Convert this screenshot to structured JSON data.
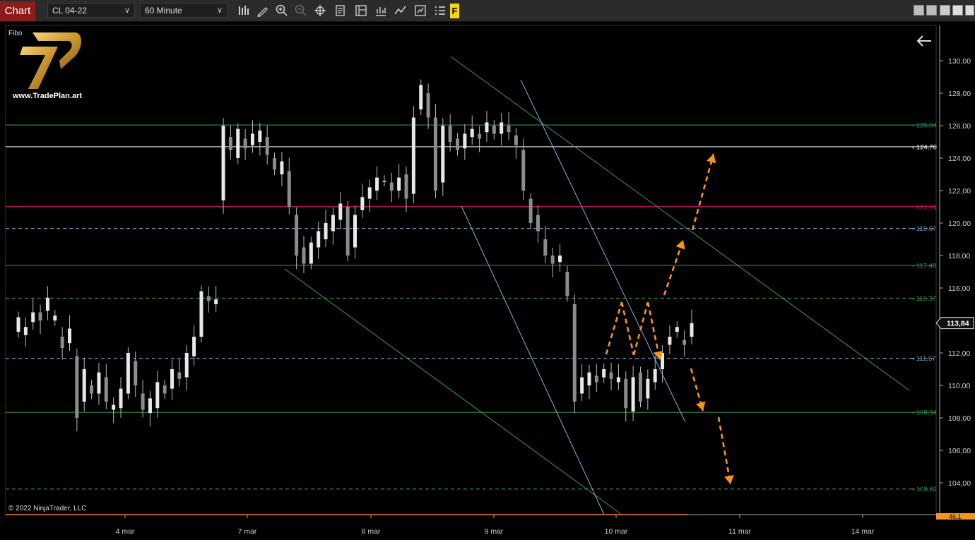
{
  "toolbar": {
    "tab_label": "Chart",
    "instrument": "CL 04-22",
    "interval": "60 Minute",
    "highlight_label": "F"
  },
  "panel": {
    "indicator_label": "Fibo",
    "logo_text": "www.TradePlan.art",
    "copyright": "© 2022 NinjaTrader, LLC",
    "back_icon": "arrow-left-icon"
  },
  "chart_data": {
    "type": "candlestick",
    "instrument": "CL 04-22",
    "interval": "60 Minute",
    "ylim": [
      102.8,
      131.5
    ],
    "yticks": [
      "104,00",
      "106,00",
      "108,00",
      "110,00",
      "112,00",
      "114,00",
      "116,00",
      "118,00",
      "120,00",
      "122,00",
      "124,00",
      "126,00",
      "128,00",
      "130,00"
    ],
    "xtick_labels": [
      "4 mar",
      "7 mar",
      "8 mar",
      "9 mar",
      "10 mar",
      "11 mar",
      "14 mar"
    ],
    "last_price": {
      "value": 113.84,
      "label": "113,84"
    },
    "bottom_price_label": "46,1",
    "levels": [
      {
        "value": 126.04,
        "label": "126,04",
        "color": "#2e8b57",
        "style": "solid"
      },
      {
        "value": 124.7,
        "label": "124,70",
        "color": "#c8c8c8",
        "style": "solid"
      },
      {
        "value": 121.01,
        "label": "121,01",
        "color": "#c2185b",
        "style": "solid"
      },
      {
        "value": 119.67,
        "label": "119,67",
        "color": "#6f93b3",
        "style": "dashed"
      },
      {
        "value": 117.4,
        "label": "117,40",
        "color": "#2e8b57",
        "style": "solid"
      },
      {
        "value": 115.37,
        "label": "115,37",
        "color": "#2e8b57",
        "style": "dashed"
      },
      {
        "value": 111.67,
        "label": "111,67",
        "color": "#6f93b3",
        "style": "dashed"
      },
      {
        "value": 108.34,
        "label": "108,34",
        "color": "#2e8b57",
        "style": "solid"
      },
      {
        "value": 103.62,
        "label": "103,62",
        "color": "#2e8b57",
        "style": "dashed"
      }
    ],
    "price_path": [
      [
        113.3,
        114.2
      ],
      [
        113.1,
        113.6
      ],
      [
        113.9,
        114.5
      ],
      [
        114.5,
        114.0
      ],
      [
        114.6,
        115.4
      ],
      [
        114.0,
        114.3
      ],
      [
        113.0,
        112.3
      ],
      [
        112.6,
        113.5
      ],
      [
        111.8,
        108.0
      ],
      [
        109.0,
        111.0
      ],
      [
        110.0,
        109.5
      ],
      [
        109.5,
        110.8
      ],
      [
        110.5,
        109.0
      ],
      [
        108.5,
        108.8
      ],
      [
        108.6,
        109.8
      ],
      [
        109.5,
        112.0
      ],
      [
        111.5,
        110.0
      ],
      [
        109.5,
        108.5
      ],
      [
        108.3,
        109.2
      ],
      [
        108.6,
        110.2
      ],
      [
        110.0,
        109.5
      ],
      [
        109.8,
        111.0
      ],
      [
        110.8,
        110.4
      ],
      [
        110.5,
        112.0
      ],
      [
        111.8,
        113.0
      ],
      [
        113.0,
        115.8
      ],
      [
        115.5,
        115.2
      ],
      [
        115.0,
        115.3
      ],
      [
        121.4,
        126.0
      ],
      [
        125.3,
        124.5
      ],
      [
        124.0,
        125.8
      ],
      [
        125.2,
        124.6
      ],
      [
        124.8,
        125.5
      ],
      [
        125.0,
        125.7
      ],
      [
        125.3,
        124.2
      ],
      [
        124.0,
        123.3
      ],
      [
        123.0,
        123.8
      ],
      [
        123.2,
        121.0
      ],
      [
        120.5,
        118.0
      ],
      [
        118.5,
        117.5
      ],
      [
        117.5,
        118.8
      ],
      [
        118.5,
        119.5
      ],
      [
        119.0,
        120.0
      ],
      [
        119.5,
        120.5
      ],
      [
        120.2,
        121.2
      ],
      [
        121.0,
        118.0
      ],
      [
        118.5,
        120.5
      ],
      [
        120.8,
        121.6
      ],
      [
        121.5,
        122.2
      ],
      [
        122.0,
        122.8
      ],
      [
        122.6,
        122.6
      ],
      [
        122.5,
        122.0
      ],
      [
        122.0,
        122.8
      ],
      [
        123.0,
        121.5
      ],
      [
        121.8,
        126.5
      ],
      [
        127.0,
        128.5
      ],
      [
        128.0,
        126.5
      ],
      [
        126.5,
        122.0
      ],
      [
        122.5,
        126.0
      ],
      [
        126.0,
        125.0
      ],
      [
        125.2,
        124.5
      ],
      [
        124.6,
        125.5
      ],
      [
        125.3,
        125.8
      ],
      [
        125.5,
        125.2
      ],
      [
        125.6,
        126.2
      ],
      [
        126.0,
        125.5
      ],
      [
        125.5,
        126.2
      ],
      [
        126.0,
        125.6
      ],
      [
        125.4,
        124.8
      ],
      [
        124.5,
        122.0
      ],
      [
        121.5,
        120.0
      ],
      [
        120.5,
        119.5
      ],
      [
        119.0,
        118.0
      ],
      [
        118.0,
        117.5
      ],
      [
        117.6,
        118.0
      ],
      [
        117.0,
        115.5
      ],
      [
        115.0,
        109.0
      ],
      [
        109.5,
        110.5
      ],
      [
        110.0,
        110.8
      ],
      [
        110.6,
        110.2
      ],
      [
        110.5,
        111.0
      ],
      [
        110.8,
        110.4
      ],
      [
        110.2,
        110.5
      ],
      [
        110.4,
        108.6
      ],
      [
        108.4,
        110.5
      ],
      [
        110.8,
        109.0
      ],
      [
        109.2,
        110.4
      ],
      [
        110.2,
        111.0
      ],
      [
        111.0,
        112.0
      ],
      [
        112.5,
        113.0
      ],
      [
        113.3,
        113.6
      ],
      [
        112.8,
        112.5
      ],
      [
        113.0,
        113.84
      ]
    ],
    "notes": "Prices use comma decimals on the axis. Orange dashed arrows mark projected moves; green and blue diagonal lines are trendlines."
  }
}
